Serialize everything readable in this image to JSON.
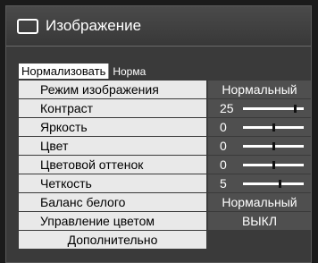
{
  "title": "Изображение",
  "normalize_button": "Нормализовать",
  "norma_label": "Норма",
  "items": [
    {
      "label": "Режим изображения",
      "value": "Нормальный"
    },
    {
      "label": "Контраст",
      "value": "25",
      "level": 0.85
    },
    {
      "label": "Яркость",
      "value": "0",
      "level": 0.5
    },
    {
      "label": "Цвет",
      "value": "0",
      "level": 0.5
    },
    {
      "label": "Цветовой оттенок",
      "value": "0",
      "level": 0.5
    },
    {
      "label": "Четкость",
      "value": "5",
      "level": 0.6
    },
    {
      "label": "Баланс белого",
      "value": "Нормальный"
    },
    {
      "label": "Управление цветом",
      "value": "ВЫКЛ"
    }
  ],
  "more_label": "Дополнительно"
}
